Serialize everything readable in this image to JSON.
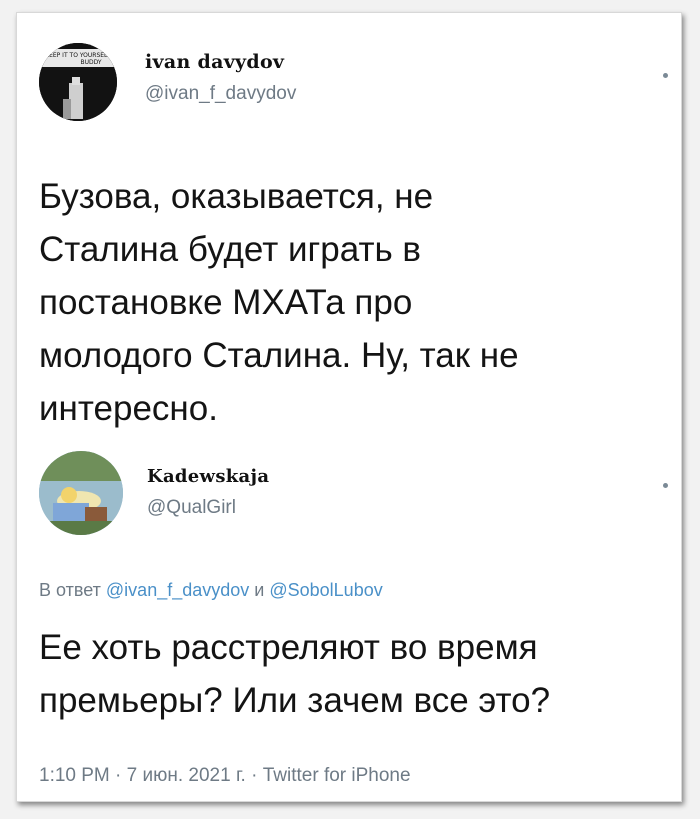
{
  "tweet": {
    "author_name": "ivan davydov",
    "author_handle": "@ivan_f_davydov",
    "avatar_caption": "KEEP IT TO YOURSELF, BUDDY",
    "text": "Бузова, оказывается, не Сталина будет играть в постановке МХАТа про молодого Сталина. Ну, так не интересно.",
    "lines": [
      "Бузова, оказывается, не",
      "Сталина будет играть в",
      "постановке МХАТа про",
      "молодого Сталина. Ну, так не",
      "интересно."
    ]
  },
  "reply": {
    "author_name": "Kadewskaja",
    "author_handle": "@QualGirl",
    "reply_prefix": "В ответ",
    "mention1": "@ivan_f_davydov",
    "conj": "и",
    "mention2": "@SobolLubov",
    "lines": [
      "Ее хоть расстреляют во время",
      "премьеры? Или зачем все это?"
    ],
    "meta": "1:10 PM · 7 июн. 2021 г. · Twitter for iPhone"
  },
  "colors": {
    "text": "#141414",
    "secondary": "#6e7a85",
    "link": "#4a90c8"
  }
}
